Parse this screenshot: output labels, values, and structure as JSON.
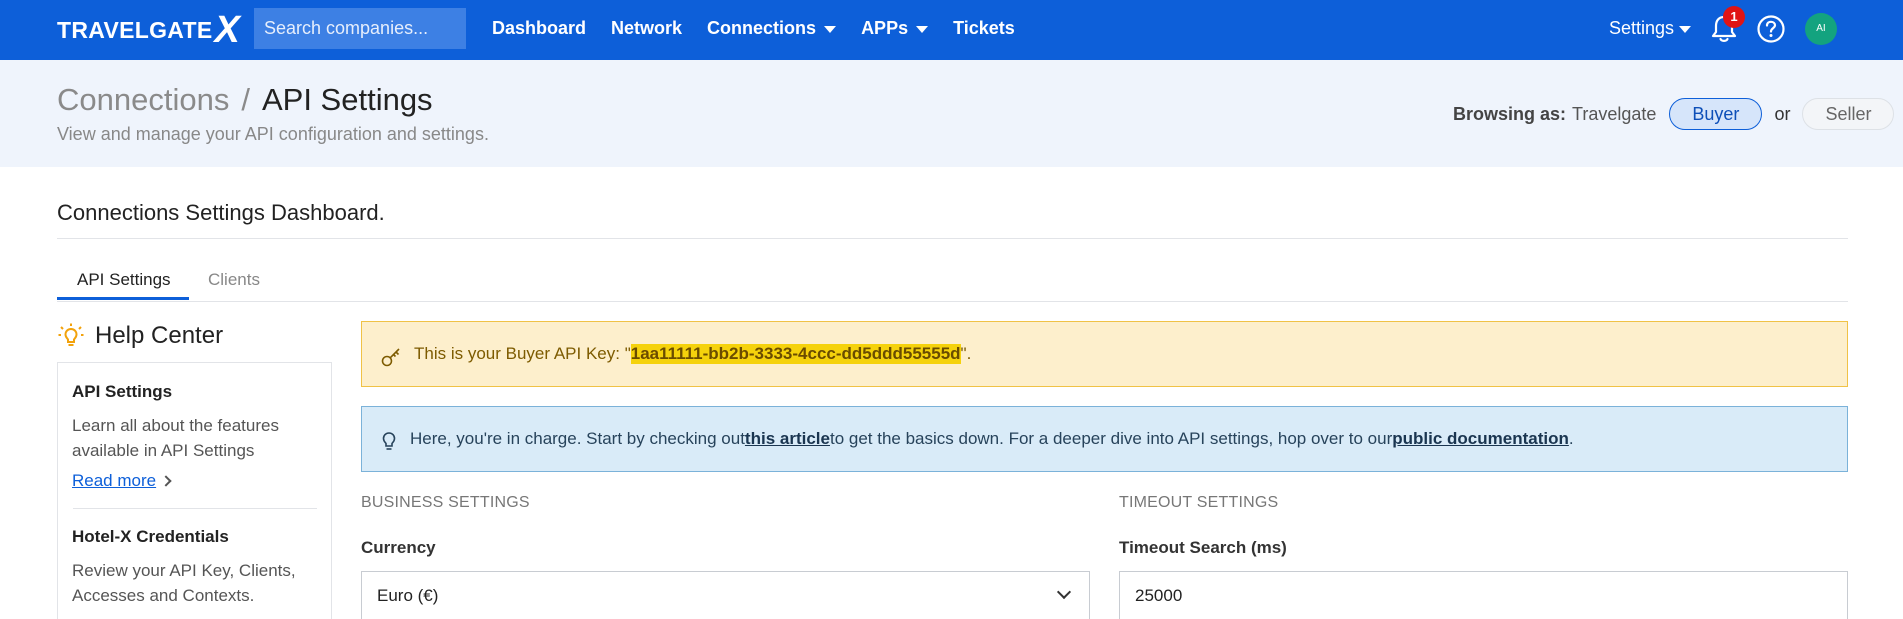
{
  "nav": {
    "logo_text": "TRAVELGATE",
    "logo_mark": "X",
    "search_placeholder": "Search companies...",
    "items": [
      {
        "label": "Dashboard",
        "dropdown": false
      },
      {
        "label": "Network",
        "dropdown": false
      },
      {
        "label": "Connections",
        "dropdown": true
      },
      {
        "label": "APPs",
        "dropdown": true
      },
      {
        "label": "Tickets",
        "dropdown": false
      }
    ],
    "settings_label": "Settings",
    "notification_count": "1",
    "avatar_initials": "AI",
    "bar_color": "#0d5fd9"
  },
  "header": {
    "breadcrumb_parent": "Connections",
    "breadcrumb_separator": "/",
    "breadcrumb_current": "API Settings",
    "subtitle": "View and manage your API configuration and settings.",
    "browsing_label": "Browsing as:",
    "browsing_company": "Travelgate",
    "role_buyer": "Buyer",
    "role_or": "or",
    "role_seller": "Seller"
  },
  "dashboard_title": "Connections Settings Dashboard.",
  "tabs": [
    {
      "label": "API Settings",
      "active": true
    },
    {
      "label": "Clients",
      "active": false
    }
  ],
  "help_center": {
    "title": "Help Center",
    "sections": [
      {
        "heading": "API Settings",
        "text": "Learn all about the features available in API Settings",
        "link": "Read more"
      },
      {
        "heading": "Hotel-X Credentials",
        "text": "Review your API Key, Clients, Accesses and Contexts."
      }
    ]
  },
  "api_key_alert": {
    "prefix": "This is your Buyer API Key: \"",
    "key": "1aa11111-bb2b-3333-4ccc-dd5ddd55555d",
    "suffix": "\"."
  },
  "info_alert": {
    "part1": "Here, you're in charge. Start by checking out ",
    "link1": "this article",
    "part2": " to get the basics down. For a deeper dive into API settings, hop over to our ",
    "link2": "public documentation",
    "part3": "."
  },
  "business_settings": {
    "section_title": "BUSINESS SETTINGS",
    "currency_label": "Currency",
    "currency_value": "Euro (€)"
  },
  "timeout_settings": {
    "section_title": "TIMEOUT SETTINGS",
    "search_label": "Timeout Search (ms)",
    "search_value": "25000"
  }
}
